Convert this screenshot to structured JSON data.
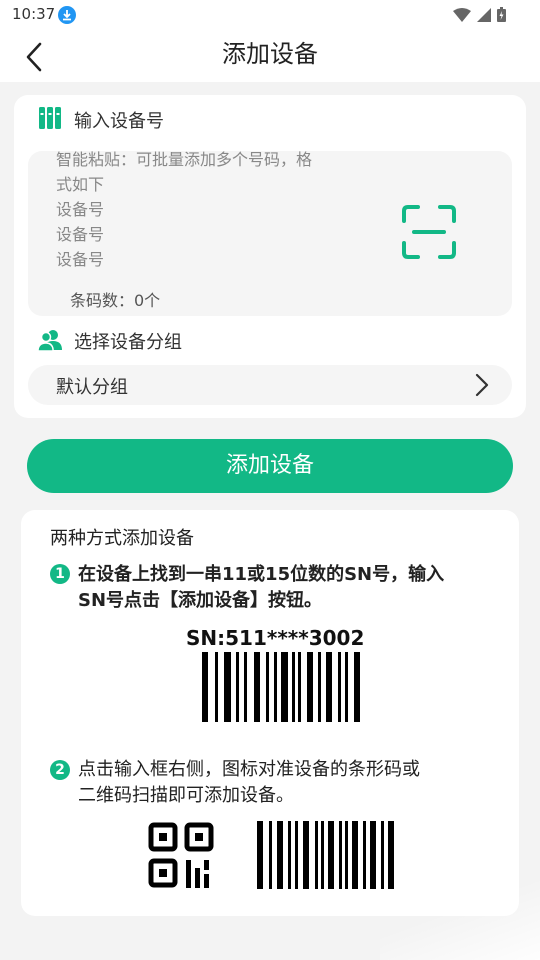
{
  "status_bar": {
    "time": "10:37"
  },
  "header": {
    "title": "添加设备",
    "back_icon": "chevron-left-icon"
  },
  "device_input": {
    "section_label": "输入设备号",
    "section_icon": "books-icon",
    "placeholder_lines": [
      "智能粘贴：可批量添加多个号码，格",
      "式如下",
      "设备号",
      "设备号",
      "设备号"
    ],
    "barcode_count": "条码数：0个",
    "scan_icon": "scan-icon"
  },
  "group": {
    "section_label": "选择设备分组",
    "section_icon": "users-icon",
    "selected": "默认分组"
  },
  "add_button": {
    "label": "添加设备"
  },
  "help": {
    "title": "两种方式添加设备",
    "step1": {
      "num": "1",
      "lines": [
        "在设备上找到一串11或15位数的SN号，输入",
        "SN号点击【添加设备】按钮。"
      ]
    },
    "sn_example": "SN:511****3002",
    "step2": {
      "num": "2",
      "lines": [
        "点击输入框右侧，图标对准设备的条形码或",
        "二维码扫描即可添加设备。"
      ]
    }
  },
  "colors": {
    "accent": "#12b886",
    "background": "#f3f3f3",
    "card": "#ffffff"
  }
}
